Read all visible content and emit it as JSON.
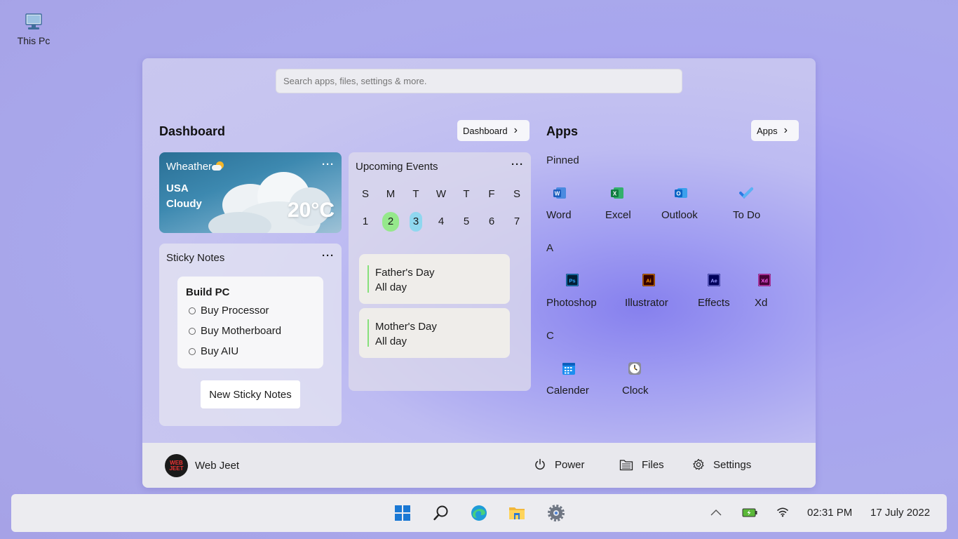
{
  "desktop": {
    "this_pc_label": "This Pc"
  },
  "search": {
    "placeholder": "Search apps, files, settings & more."
  },
  "dashboard": {
    "title": "Dashboard",
    "button_label": "Dashboard",
    "weather": {
      "title": "Wheather",
      "city": "USA",
      "condition": "Cloudy",
      "temperature": "20°C",
      "menu": "···"
    },
    "sticky_notes": {
      "title": "Sticky Notes",
      "menu": "···",
      "note_title": "Build PC",
      "items": [
        "Buy Processor",
        "Buy Motherboard",
        "Buy AIU"
      ],
      "new_button": "New Sticky Notes"
    },
    "events": {
      "title": "Upcoming Events",
      "menu": "···",
      "weekdays": [
        "S",
        "M",
        "T",
        "W",
        "T",
        "F",
        "S"
      ],
      "days": [
        "1",
        "2",
        "3",
        "4",
        "5",
        "6",
        "7"
      ],
      "highlight_colors": {
        "day2": "#95e88b",
        "day3": "#8fd7ef"
      },
      "list": [
        {
          "name": "Father's Day",
          "when": "All day"
        },
        {
          "name": "Mother's Day",
          "when": "All day"
        }
      ]
    }
  },
  "apps": {
    "title": "Apps",
    "button_label": "Apps",
    "pinned_label": "Pinned",
    "pinned": [
      "Word",
      "Excel",
      "Outlook",
      "To Do"
    ],
    "group_a_label": "A",
    "group_a": [
      "Photoshop",
      "Illustrator",
      "Effects",
      "Xd"
    ],
    "group_c_label": "C",
    "group_c": [
      "Calender",
      "Clock"
    ]
  },
  "footer": {
    "avatar_text": "WEB JEET",
    "user_name": "Web Jeet",
    "power": "Power",
    "files": "Files",
    "settings": "Settings"
  },
  "taskbar": {
    "time": "02:31 PM",
    "date": "17 July 2022"
  }
}
